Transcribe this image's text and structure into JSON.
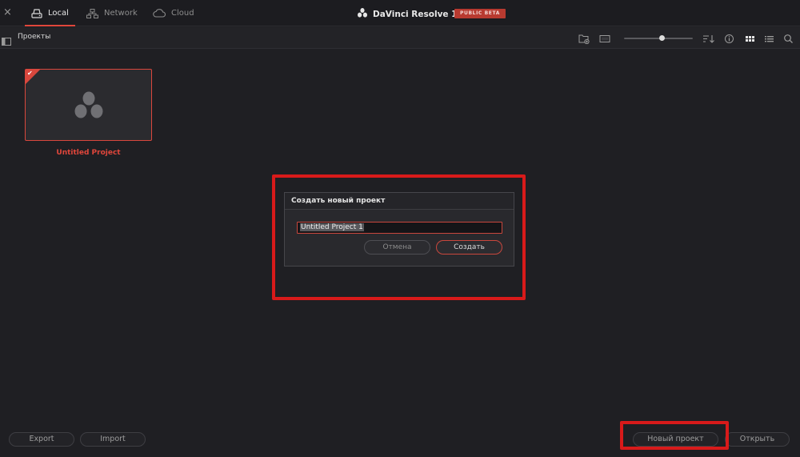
{
  "topbar": {
    "close_glyph": "×",
    "tabs": [
      {
        "label": "Local",
        "icon": "drive-icon",
        "active": true
      },
      {
        "label": "Network",
        "icon": "network-icon",
        "active": false
      },
      {
        "label": "Cloud",
        "icon": "cloud-icon",
        "active": false
      }
    ],
    "app_name": "DaVinci Resolve 19",
    "badge": "PUBLIC BETA"
  },
  "toolbar": {
    "title": "Проекты",
    "zoom_level": 0.55,
    "icons": [
      "new-folder-icon",
      "monitor-icon",
      "sort-icon",
      "info-icon",
      "grid-view-icon",
      "list-view-icon",
      "search-icon"
    ]
  },
  "projects": [
    {
      "title": "Untitled Project",
      "selected": true
    }
  ],
  "dialog": {
    "title": "Создать новый проект",
    "input_value": "Untitled Project 1",
    "cancel_label": "Отмена",
    "create_label": "Создать"
  },
  "bottom": {
    "export_label": "Export",
    "import_label": "Import",
    "new_project_label": "Новый проект",
    "open_label": "Открыть"
  },
  "colors": {
    "accent": "#e0463b",
    "highlight": "#d81a1a",
    "background": "#1f1f23"
  }
}
